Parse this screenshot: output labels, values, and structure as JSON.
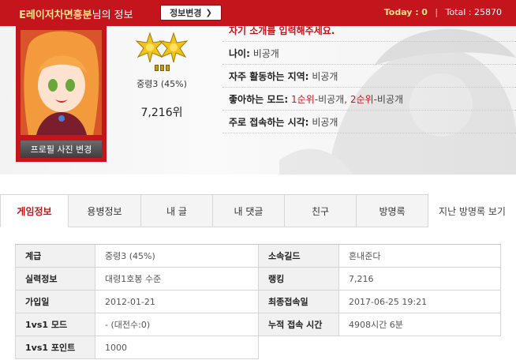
{
  "header": {
    "nickname": "E레이저차면흥분",
    "nickname_suffix": "님의 정보",
    "edit_button": "정보변경",
    "today_label": "Today :",
    "today_value": "0",
    "total_label": "Total :",
    "total_value": "25870"
  },
  "profile": {
    "photo_change_button": "프로필 사진 변경",
    "grade": "중령3 (45%)",
    "rank": "7,216위",
    "intro": "자기 소개를 입력해주세요.",
    "age_label": "나이:",
    "age_value": "비공개",
    "region_label": "자주 활동하는 지역:",
    "region_value": "비공개",
    "mode_label": "좋아하는 모드:",
    "mode_first": "1순위",
    "mode_first_value": "-비공개,",
    "mode_second": "2순위",
    "mode_second_value": "-비공개",
    "time_label": "주로 접속하는 시각:",
    "time_value": "비공개"
  },
  "tabs": [
    "게임정보",
    "용병정보",
    "내 글",
    "내 댓글",
    "친구",
    "방명록",
    "지난 방명록 보기"
  ],
  "game_info": {
    "rows": [
      [
        "계급",
        "중령3 (45%)",
        "소속길드",
        "혼내준다"
      ],
      [
        "실력정보",
        "대령1호봉 수준",
        "랭킹",
        "7,216"
      ],
      [
        "가입일",
        "2012-01-21",
        "최종접속일",
        "2017-06-25 19:21"
      ],
      [
        "1vs1 모드",
        "- (대전수:0)",
        "누적 접속 시간",
        "4908시간 6분"
      ],
      [
        "1vs1 포인트",
        "1000",
        "",
        ""
      ]
    ]
  },
  "colors": {
    "accent": "#c3151b",
    "gold": "#ffe28a"
  },
  "icons": [
    "chevron-right-icon",
    "medal-icon",
    "rank-bar-icon"
  ]
}
